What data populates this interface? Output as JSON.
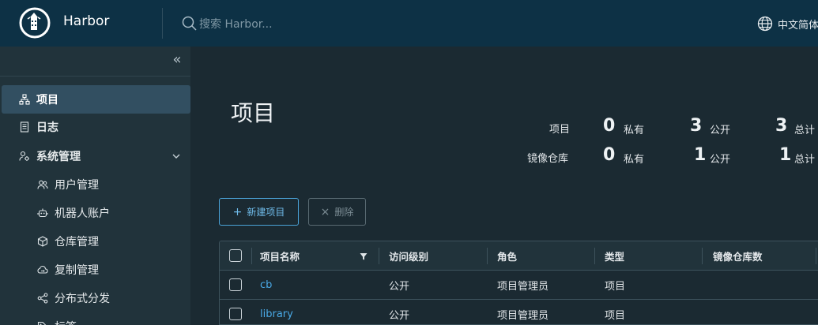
{
  "header": {
    "brand": "Harbor",
    "search_placeholder": "搜索 Harbor...",
    "language": "中文简体"
  },
  "sidebar": {
    "items": [
      {
        "label": "项目",
        "icon": "projects-icon",
        "active": true
      },
      {
        "label": "日志",
        "icon": "logs-icon"
      },
      {
        "label": "系统管理",
        "icon": "admin-icon",
        "expanded": true
      },
      {
        "label": "用户管理",
        "icon": "users-icon"
      },
      {
        "label": "机器人账户",
        "icon": "robot-icon"
      },
      {
        "label": "仓库管理",
        "icon": "registry-icon"
      },
      {
        "label": "复制管理",
        "icon": "replication-icon"
      },
      {
        "label": "分布式分发",
        "icon": "share-icon"
      },
      {
        "label": "标签",
        "icon": "tag-icon"
      }
    ]
  },
  "main": {
    "title": "项目",
    "stats": {
      "projects_label": "项目",
      "repos_label": "镜像仓库",
      "private_unit": "私有",
      "public_unit": "公开",
      "total_unit": "总计",
      "projects_private": "0",
      "projects_public": "3",
      "projects_total": "3",
      "repos_private": "0",
      "repos_public": "1",
      "repos_total": "1"
    },
    "buttons": {
      "new_project": "新建项目",
      "delete": "删除"
    },
    "table": {
      "columns": [
        "项目名称",
        "访问级别",
        "角色",
        "类型",
        "镜像仓库数"
      ],
      "rows": [
        {
          "name": "cb",
          "access": "公开",
          "role": "项目管理员",
          "type": "项目"
        },
        {
          "name": "library",
          "access": "公开",
          "role": "项目管理员",
          "type": "项目"
        }
      ]
    }
  },
  "colors": {
    "header_bg": "#0d3145",
    "sidebar_bg": "#21333b",
    "main_bg": "#1b2a32",
    "accent": "#4aa9e6"
  }
}
